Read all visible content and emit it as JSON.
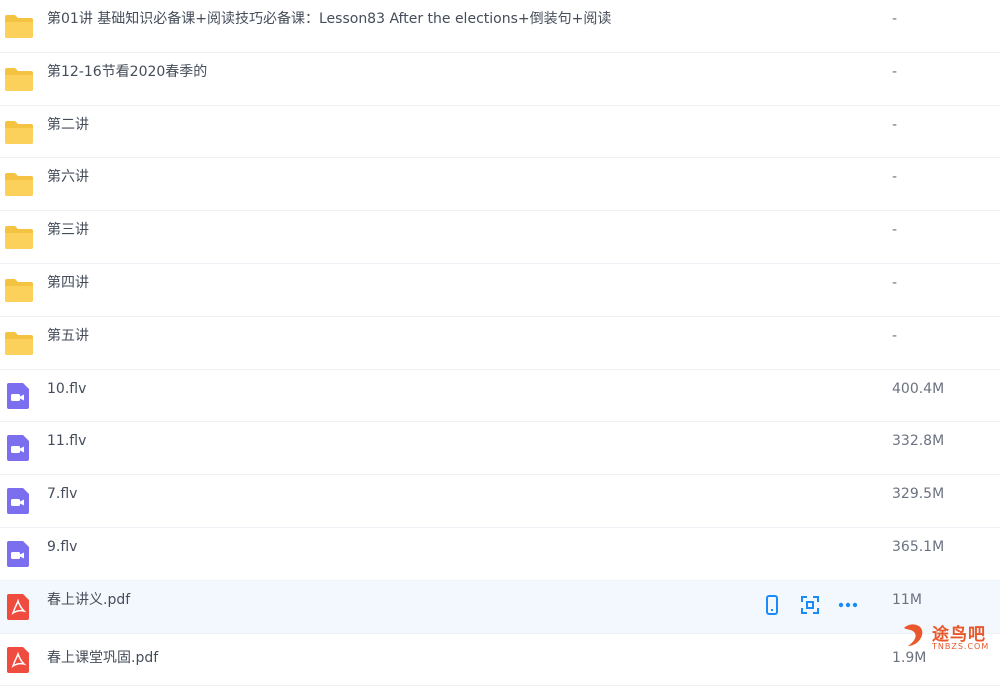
{
  "files": [
    {
      "type": "folder",
      "icon": "folder-icon",
      "name": "第01讲 基础知识必备课+阅读技巧必备课：Lesson83 After the elections+倒装句+阅读",
      "size": "-"
    },
    {
      "type": "folder",
      "icon": "folder-icon",
      "name": "第12-16节看2020春季的",
      "size": "-"
    },
    {
      "type": "folder",
      "icon": "folder-icon",
      "name": "第二讲",
      "size": "-"
    },
    {
      "type": "folder",
      "icon": "folder-icon",
      "name": "第六讲",
      "size": "-"
    },
    {
      "type": "folder",
      "icon": "folder-icon",
      "name": "第三讲",
      "size": "-"
    },
    {
      "type": "folder",
      "icon": "folder-icon",
      "name": "第四讲",
      "size": "-"
    },
    {
      "type": "folder",
      "icon": "folder-icon",
      "name": "第五讲",
      "size": "-"
    },
    {
      "type": "video",
      "icon": "video-file-icon",
      "name": "10.flv",
      "size": "400.4M"
    },
    {
      "type": "video",
      "icon": "video-file-icon",
      "name": "11.flv",
      "size": "332.8M"
    },
    {
      "type": "video",
      "icon": "video-file-icon",
      "name": "7.flv",
      "size": "329.5M"
    },
    {
      "type": "video",
      "icon": "video-file-icon",
      "name": "9.flv",
      "size": "365.1M"
    },
    {
      "type": "pdf",
      "icon": "pdf-file-icon",
      "name": "春上讲义.pdf",
      "size": "11M",
      "selected": true,
      "actions": [
        "phone-icon",
        "share-icon",
        "more-icon"
      ]
    },
    {
      "type": "pdf",
      "icon": "pdf-file-icon",
      "name": "春上课堂巩固.pdf",
      "size": "1.9M"
    }
  ],
  "watermark": {
    "text": "途鸟吧",
    "sub": "TNBZS.COM"
  },
  "colors": {
    "folder": "#f5c342",
    "video": "#7b6ff0",
    "pdf": "#ef4b3f",
    "action": "#1a8cf5",
    "selected_row": "#f2f8fd"
  }
}
